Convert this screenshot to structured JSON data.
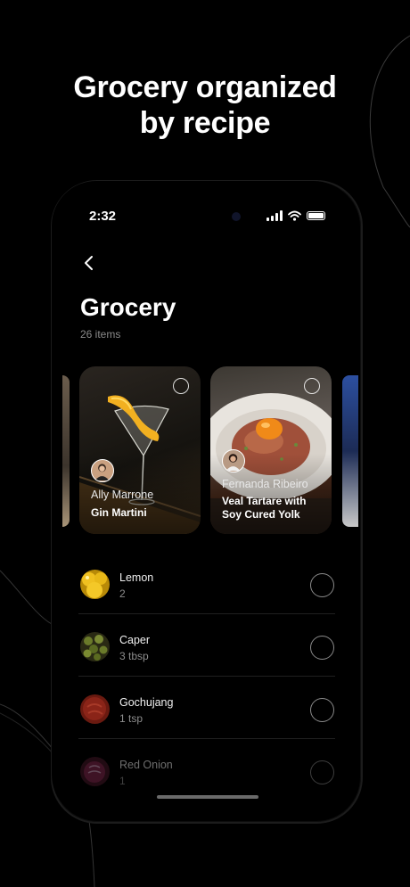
{
  "headline": {
    "line1": "Grocery organized",
    "line2": "by recipe"
  },
  "status_bar": {
    "time": "2:32"
  },
  "page": {
    "title": "Grocery",
    "item_count": "26 items"
  },
  "cards": [
    {
      "author": "Ally Marrone",
      "recipe": "Gin Martini"
    },
    {
      "author": "Fernanda Ribeiro",
      "recipe_line1": "Veal Tartare with",
      "recipe_line2": "Soy Cured Yolk"
    }
  ],
  "items": [
    {
      "name": "Lemon",
      "qty": "2",
      "color": "#e8b818"
    },
    {
      "name": "Caper",
      "qty": "3 tbsp",
      "color": "#6a7a2a"
    },
    {
      "name": "Gochujang",
      "qty": "1 tsp",
      "color": "#8a2418"
    },
    {
      "name": "Red Onion",
      "qty": "1",
      "color": "#7a2a4a"
    }
  ],
  "colors": {
    "background": "#000000",
    "text": "#ffffff",
    "muted": "#8a8a8a"
  }
}
